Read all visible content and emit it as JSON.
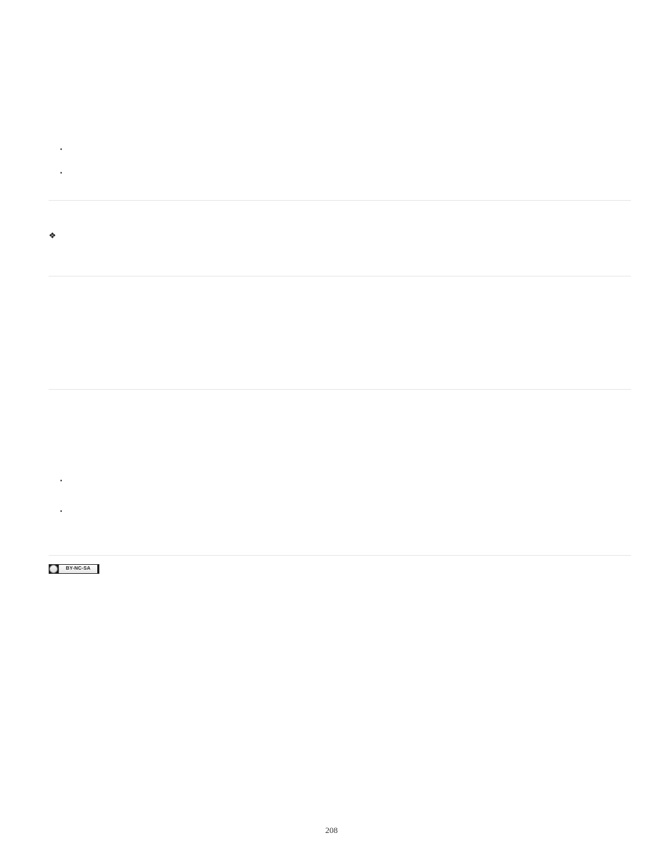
{
  "bullets_top": {
    "b1": "",
    "b2": ""
  },
  "diamond_section": {
    "marker": "❖",
    "lines": [
      "",
      ""
    ]
  },
  "middle_block": {
    "lines": [
      "",
      "",
      "",
      "",
      ""
    ]
  },
  "bottom_block": {
    "intro_lines": [
      "",
      "",
      "",
      ""
    ],
    "bullets": [
      {
        "text_lines": [
          "",
          ""
        ]
      },
      {
        "text_lines": [
          "",
          "",
          ""
        ]
      }
    ]
  },
  "license": {
    "badge_text": "BY-NC-SA"
  },
  "page_number": "208"
}
